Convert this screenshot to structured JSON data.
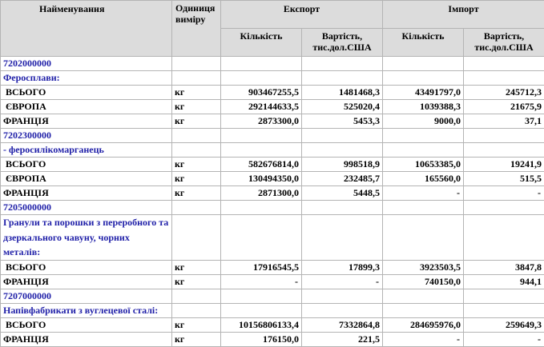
{
  "header": {
    "name": "Найменування",
    "unit_line1": "Одиниця",
    "unit_line2": "виміру",
    "export": "Експорт",
    "import": "Імпорт",
    "qty": "Кількість",
    "value_line1": "Вартість,",
    "value_line2": "тис.дол.США"
  },
  "sections": [
    {
      "code": "7202000000",
      "desc": "Феросплави:",
      "rows": [
        {
          "label": "ВСЬОГО",
          "unit": "кг",
          "exp_qty": "903467255,5",
          "exp_val": "1481468,3",
          "imp_qty": "43491797,0",
          "imp_val": "245712,3"
        },
        {
          "label": "ЄВРОПА",
          "unit": "кг",
          "exp_qty": "292144633,5",
          "exp_val": "525020,4",
          "imp_qty": "1039388,3",
          "imp_val": "21675,9"
        },
        {
          "label": "ФРАНЦІЯ",
          "unit": "кг",
          "exp_qty": "2873300,0",
          "exp_val": "5453,3",
          "imp_qty": "9000,0",
          "imp_val": "37,1"
        }
      ]
    },
    {
      "code": "7202300000",
      "desc": "- феросилікомарганець",
      "rows": [
        {
          "label": "ВСЬОГО",
          "unit": "кг",
          "exp_qty": "582676814,0",
          "exp_val": "998518,9",
          "imp_qty": "10653385,0",
          "imp_val": "19241,9"
        },
        {
          "label": "ЄВРОПА",
          "unit": "кг",
          "exp_qty": "130494350,0",
          "exp_val": "232485,7",
          "imp_qty": "165560,0",
          "imp_val": "515,5"
        },
        {
          "label": "ФРАНЦІЯ",
          "unit": "кг",
          "exp_qty": "2871300,0",
          "exp_val": "5448,5",
          "imp_qty": "-",
          "imp_val": "-"
        }
      ]
    },
    {
      "code": "7205000000",
      "desc": "Гранули та порошки з переробного та дзеркального чавуну, чорних металів:",
      "rows": [
        {
          "label": "ВСЬОГО",
          "unit": "кг",
          "exp_qty": "17916545,5",
          "exp_val": "17899,3",
          "imp_qty": "3923503,5",
          "imp_val": "3847,8"
        },
        {
          "label": "ФРАНЦІЯ",
          "unit": "кг",
          "exp_qty": "-",
          "exp_val": "-",
          "imp_qty": "740150,0",
          "imp_val": "944,1"
        }
      ]
    },
    {
      "code": "7207000000",
      "desc": "Напівфабрикати з вуглецевої сталі:",
      "rows": [
        {
          "label": "ВСЬОГО",
          "unit": "кг",
          "exp_qty": "10156806133,4",
          "exp_val": "7332864,8",
          "imp_qty": "284695976,0",
          "imp_val": "259649,3"
        },
        {
          "label": "ФРАНЦІЯ",
          "unit": "кг",
          "exp_qty": "176150,0",
          "exp_val": "221,5",
          "imp_qty": "-",
          "imp_val": "-"
        }
      ]
    }
  ]
}
